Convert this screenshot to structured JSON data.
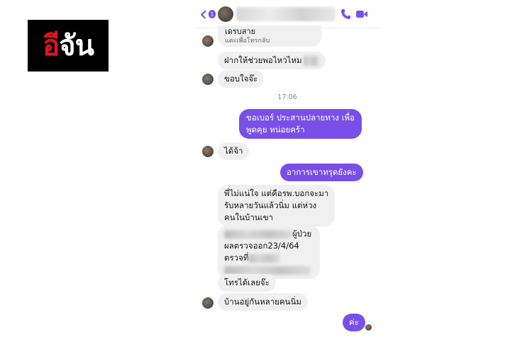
{
  "logo": {
    "part1": "อี",
    "part2": "จัน"
  },
  "header": {
    "unread_count": "1"
  },
  "call_card": {
    "title": "เดรบสาย",
    "subtitle": "แตะเพื่อโทรกลับ"
  },
  "messages": {
    "m1": "ฝากให้ช่วยพอไหวไหม",
    "m2": "ขอบใจจ๊ะ",
    "time": "17:06",
    "m3_line1": "ขอเบอร์ ประสานปลายทาง เพื่อ",
    "m3_line2": "พูดคุย หน่อยคร้า",
    "m4": "ได้จ้า",
    "m5": "อาการเขาทรุดยังคะ",
    "m6_line1": "พี่ไม่แน่ใจ แต่คือรพ.บอกจะมา",
    "m6_line2": "รับหลายวันแล้วนิ่ม แต่ห่วง",
    "m6_line3": "คนในบ้านเขา",
    "m7_line1_suffix": "ผู้ป่วย",
    "m7_line2": "ผลตรวจออก23/4/64",
    "m7_line3": "ตรวจที่",
    "m8": "โทรได้เลยจ๊ะ",
    "m9": "บ้านอยู่กันหลายคนนิ่ม",
    "m10": "ค่ะ"
  },
  "colors": {
    "accent": "#7a4fe8",
    "incoming_bubble": "#f0f0f0",
    "logo_red": "#e0141f"
  },
  "icons": [
    "back-chevron-icon",
    "phone-icon",
    "video-call-icon"
  ]
}
